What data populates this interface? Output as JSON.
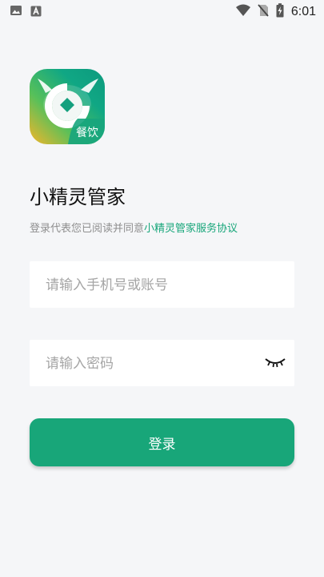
{
  "status_bar": {
    "time": "6:01",
    "icons": [
      "image-icon",
      "a-icon",
      "wifi-icon",
      "no-sim-icon",
      "battery-charging-icon"
    ]
  },
  "app": {
    "logo_badge": "餐饮",
    "title": "小精灵管家"
  },
  "agreement": {
    "prefix": "登录代表您已阅读并同意",
    "link": "小精灵管家服务协议"
  },
  "form": {
    "account_placeholder": "请输入手机号或账号",
    "account_value": "",
    "password_placeholder": "请输入密码",
    "password_value": "",
    "login_label": "登录"
  },
  "colors": {
    "accent": "#18a679",
    "background": "#f5f6f8"
  }
}
